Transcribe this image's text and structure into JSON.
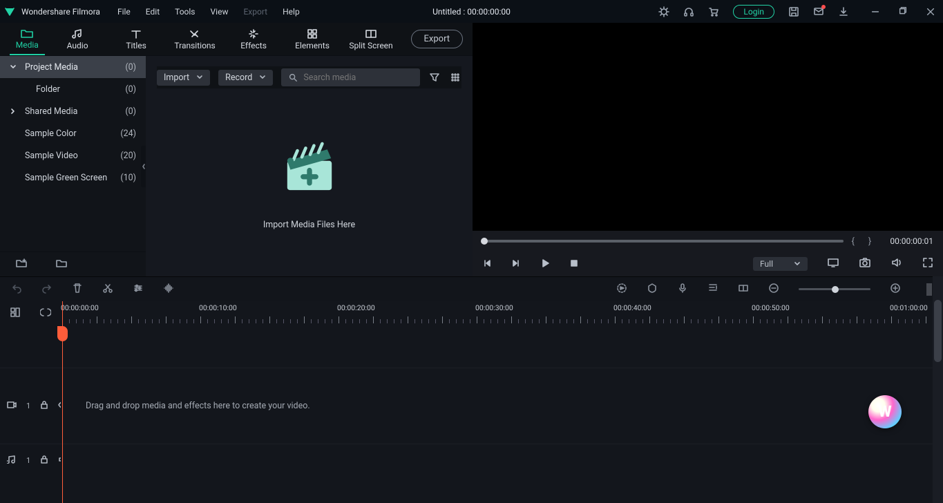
{
  "app_name": "Wondershare Filmora",
  "document_title": "Untitled : 00:00:00:00",
  "login_label": "Login",
  "menu": {
    "file": "File",
    "edit": "Edit",
    "tools": "Tools",
    "view": "View",
    "export": "Export",
    "help": "Help"
  },
  "tabs": {
    "media": "Media",
    "audio": "Audio",
    "titles": "Titles",
    "transitions": "Transitions",
    "effects": "Effects",
    "elements": "Elements",
    "split": "Split Screen"
  },
  "export_btn": "Export",
  "sidebar": {
    "project_media": {
      "label": "Project Media",
      "count": "(0)"
    },
    "folder": {
      "label": "Folder",
      "count": "(0)"
    },
    "shared": {
      "label": "Shared Media",
      "count": "(0)"
    },
    "sample_color": {
      "label": "Sample Color",
      "count": "(24)"
    },
    "sample_video": {
      "label": "Sample Video",
      "count": "(20)"
    },
    "sample_green": {
      "label": "Sample Green Screen",
      "count": "(10)"
    }
  },
  "mid": {
    "import": "Import",
    "record": "Record",
    "search_ph": "Search media",
    "empty_text": "Import Media Files Here"
  },
  "preview": {
    "timecode": "00:00:00:01",
    "quality": "Full"
  },
  "timeline": {
    "ruler": [
      "00:00:00:00",
      "00:00:10:00",
      "00:00:20:00",
      "00:00:30:00",
      "00:00:40:00",
      "00:00:50:00",
      "00:01:00:00"
    ],
    "track_video_label": "1",
    "track_audio_label": "1",
    "hint": "Drag and drop media and effects here to create your video."
  }
}
